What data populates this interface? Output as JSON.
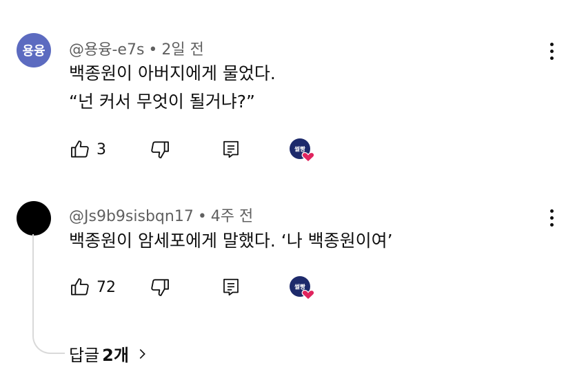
{
  "comments": [
    {
      "avatar_text": "용융",
      "author": "@용융-e7s",
      "time": "2일 전",
      "lines": [
        "백종원이 아버지에게 물었다.",
        "“넌 커서 무엇이 될거냐?”"
      ],
      "likes": "3",
      "creator_badge": "썰빵"
    },
    {
      "avatar_text": "",
      "author": "@Js9b9sisbqn17",
      "time": "4주 전",
      "lines": [
        "백종원이 암세포에게 말했다. ‘나 백종원이여’"
      ],
      "likes": "72",
      "creator_badge": "썰빵"
    }
  ],
  "replies": {
    "prefix": "답글",
    "count": "2개"
  },
  "separator": "•",
  "colors": {
    "avatar_purple": "#5c6bc0",
    "badge_navy": "#1d2a6b",
    "heart_red": "#e0245e"
  }
}
